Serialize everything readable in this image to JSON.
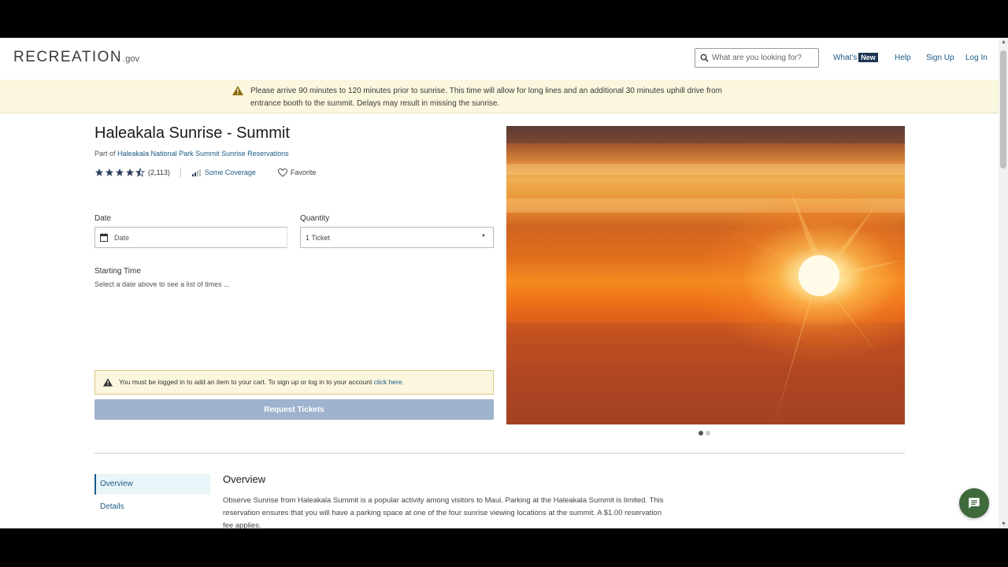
{
  "header": {
    "logo_main": "RECREATION",
    "logo_suffix": ".gov",
    "search_placeholder": "What are you looking for?",
    "nav": {
      "whats_label": "What's",
      "new_badge": "New",
      "help": "Help",
      "signup": "Sign Up",
      "login": "Log In"
    }
  },
  "banner": {
    "text": "Please arrive 90 minutes to 120 minutes prior to sunrise. This time will allow for long lines and an additional 30 minutes uphill drive from entrance booth to the summit. Delays may result in missing the sunrise."
  },
  "product": {
    "title": "Haleakala Sunrise - Summit",
    "part_of_prefix": "Part of",
    "part_of_link": "Haleakala National Park Summit Sunrise Reservations",
    "rating": 4.5,
    "review_count": "(2,113)",
    "coverage": "Some Coverage",
    "favorite": "Favorite"
  },
  "form": {
    "date_label": "Date",
    "date_placeholder": "Date",
    "quantity_label": "Quantity",
    "quantity_value": "1 Ticket",
    "starting_time_label": "Starting Time",
    "starting_time_hint": "Select a date above to see a list of times ...",
    "login_alert_text": "You must be logged in to add an item to your cart. To sign up or log in to your account",
    "login_alert_link": "click here.",
    "request_button": "Request Tickets"
  },
  "gallery": {
    "active_index": 0,
    "count": 2
  },
  "side_nav": {
    "items": [
      "Overview",
      "Details"
    ]
  },
  "overview": {
    "heading": "Overview",
    "text": "Observe Sunrise from Haleakala Summit is a popular activity among visitors to Maui. Parking at the Haleakala Summit is limited. This reservation ensures that you will have a parking space at one of the four sunrise viewing locations at the summit. A $1.00 reservation fee applies."
  },
  "colors": {
    "link": "#1a5a87",
    "banner_bg": "#fbf6de",
    "button_disabled": "#9fb2ce",
    "chat": "#3f6a3b"
  }
}
